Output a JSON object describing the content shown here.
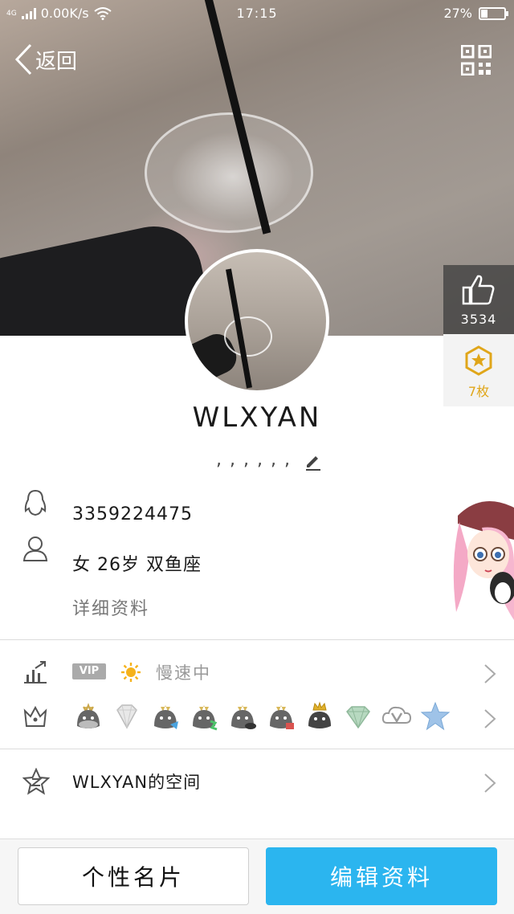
{
  "status_bar": {
    "network": "4G",
    "speed": "0.00K/s",
    "time": "17:15",
    "battery": "27%",
    "battery_level": 0.27
  },
  "nav": {
    "back_label": "返回",
    "qr_icon": "qr-code-icon"
  },
  "side": {
    "likes": "3534",
    "medals": "7枚"
  },
  "profile": {
    "nickname": "WLXYAN",
    "signature": ",,,,,,"
  },
  "info": {
    "qq_number": "3359224475",
    "basic": "女 26岁 双鱼座",
    "detail_link": "详细资料"
  },
  "vip": {
    "tag": "VIP",
    "status": "慢速中"
  },
  "badges": [
    "penguin-gray-icon",
    "diamond-icon",
    "penguin-blue-icon",
    "penguin-green-icon",
    "penguin-sleep-icon",
    "penguin-red-icon",
    "penguin-crown-icon",
    "diamond-green-icon",
    "video-v-icon",
    "star-blue-icon"
  ],
  "zone": {
    "label": "WLXYAN的空间"
  },
  "buttons": {
    "card": "个性名片",
    "edit": "编辑资料"
  },
  "colors": {
    "accent": "#2bb5ef",
    "medal": "#e0a61a"
  }
}
